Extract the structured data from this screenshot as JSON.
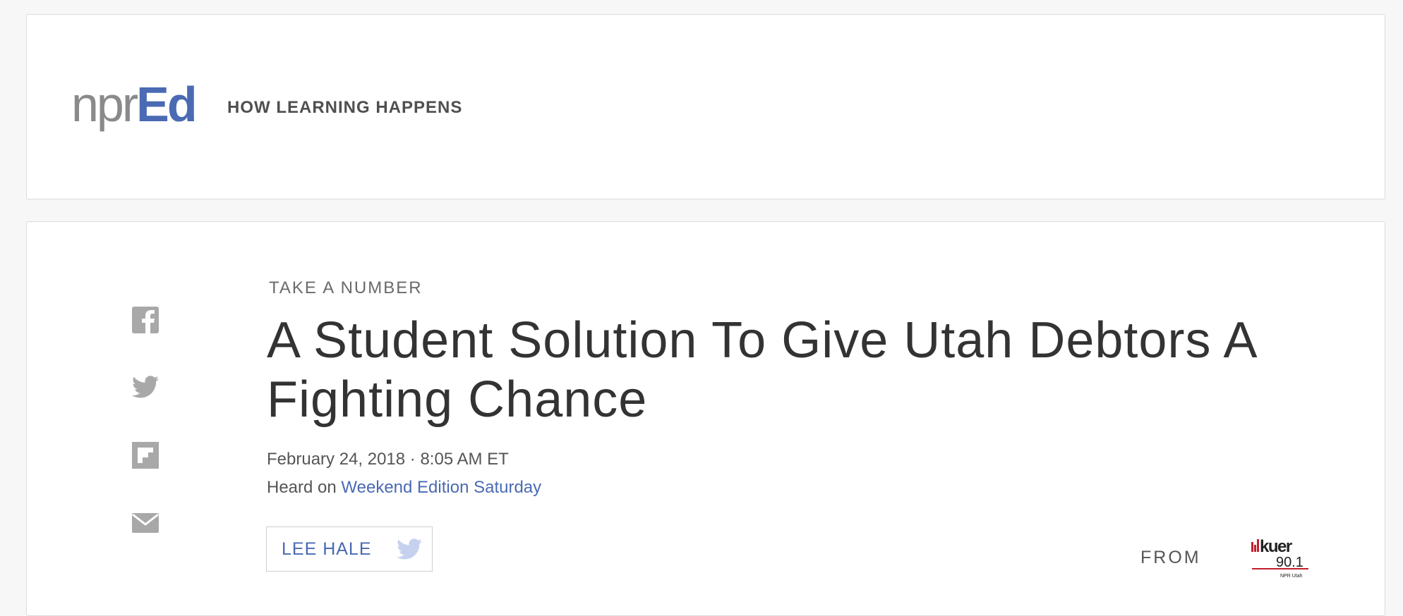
{
  "header": {
    "logo_npr": "npr",
    "logo_ed": "Ed",
    "tagline": "HOW LEARNING HAPPENS"
  },
  "social": {
    "icons": [
      "facebook-icon",
      "twitter-icon",
      "flipboard-icon",
      "email-icon"
    ]
  },
  "article": {
    "kicker": "TAKE A NUMBER",
    "headline": "A Student Solution To Give Utah Debtors A Fighting Chance",
    "date": "February 24, 2018 · 8:05 AM ET",
    "heard_prefix": "Heard on ",
    "heard_show": "Weekend Edition Saturday",
    "byline": "LEE HALE",
    "from_label": "FROM",
    "station_logo_text": "kuer",
    "station_freq": "90.1",
    "station_sub": "NPR Utah"
  },
  "colors": {
    "accent": "#4a6ab3",
    "icon_gray": "#a8a8a8",
    "twitter_light": "#c5d1ee",
    "kuer_red": "#c0202c"
  }
}
